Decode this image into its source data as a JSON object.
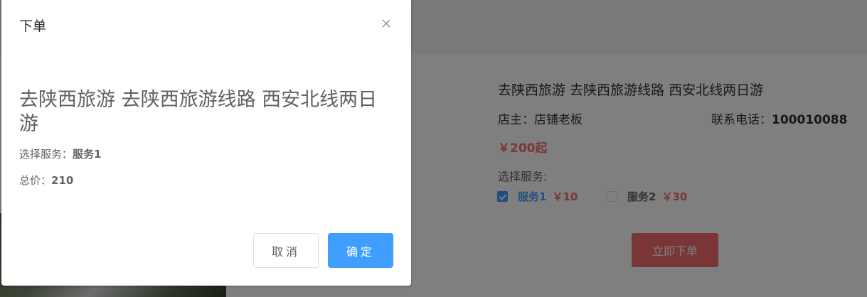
{
  "background": {
    "product_title": "去陕西旅游 去陕西旅游线路 西安北线两日游",
    "shop_label": "店主：",
    "shop_owner": "店铺老板",
    "phone_label": "联系电话：",
    "phone": "100010088",
    "price": "￥200起",
    "services_label": "选择服务:",
    "services": [
      {
        "name": "服务1",
        "price": "￥10",
        "checked": true
      },
      {
        "name": "服务2",
        "price": "￥30",
        "checked": false
      }
    ],
    "order_button": "立即下单"
  },
  "dialog": {
    "title": "下单",
    "close_icon": "close-icon",
    "product_title": "去陕西旅游 去陕西旅游线路 西安北线两日游",
    "service_label": "选择服务：",
    "service_value": "服务1",
    "total_label": "总价：",
    "total_value": "210",
    "cancel_label": "取消",
    "confirm_label": "确定"
  },
  "colors": {
    "primary": "#409eff",
    "danger": "#f56c6c",
    "overlay": "rgba(0,0,0,0.5)"
  }
}
